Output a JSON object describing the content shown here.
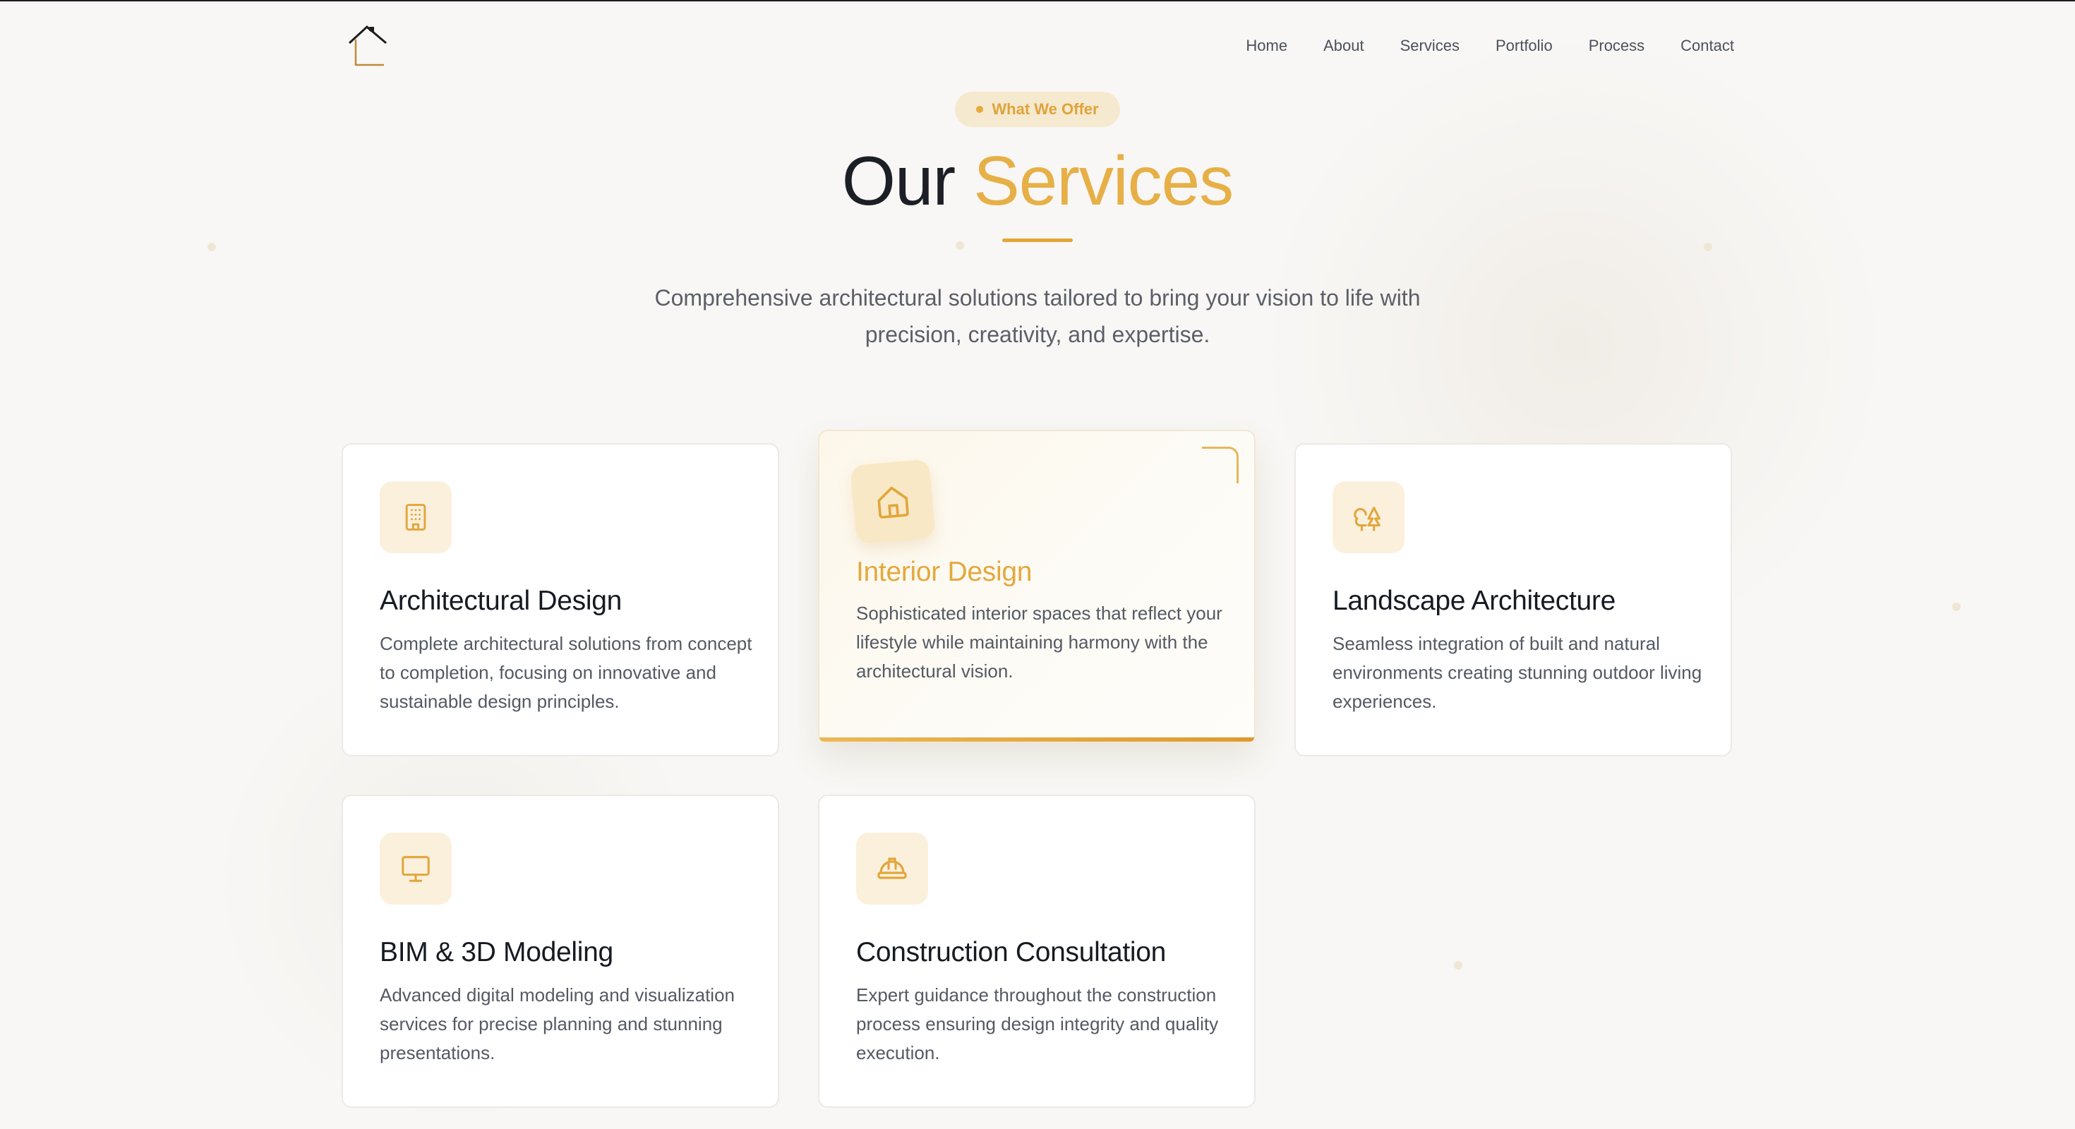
{
  "nav": {
    "items": [
      {
        "label": "Home"
      },
      {
        "label": "About"
      },
      {
        "label": "Services"
      },
      {
        "label": "Portfolio"
      },
      {
        "label": "Process"
      },
      {
        "label": "Contact"
      }
    ]
  },
  "section": {
    "badge": "What We Offer",
    "title_main": "Our",
    "title_accent": "Services",
    "subtitle": "Comprehensive architectural solutions tailored to bring your vision to life with precision, creativity, and expertise."
  },
  "services": [
    {
      "icon": "building-icon",
      "title": "Architectural Design",
      "description": "Complete architectural solutions from concept to completion, focusing on innovative and sustainable design principles."
    },
    {
      "icon": "house-icon",
      "title": "Interior Design",
      "description": "Sophisticated interior spaces that reflect your lifestyle while maintaining harmony with the architectural vision."
    },
    {
      "icon": "trees-icon",
      "title": "Landscape Architecture",
      "description": "Seamless integration of built and natural environments creating stunning outdoor living experiences."
    },
    {
      "icon": "monitor-icon",
      "title": "BIM & 3D Modeling",
      "description": "Advanced digital modeling and visualization services for precise planning and stunning presentations."
    },
    {
      "icon": "hard-hat-icon",
      "title": "Construction Consultation",
      "description": "Expert guidance throughout the construction process ensuring design integrity and quality execution."
    }
  ],
  "colors": {
    "accent": "#e6b047",
    "accent_dark": "#dd9a2f",
    "background": "#f8f7f5",
    "text": "#1c1f26"
  }
}
